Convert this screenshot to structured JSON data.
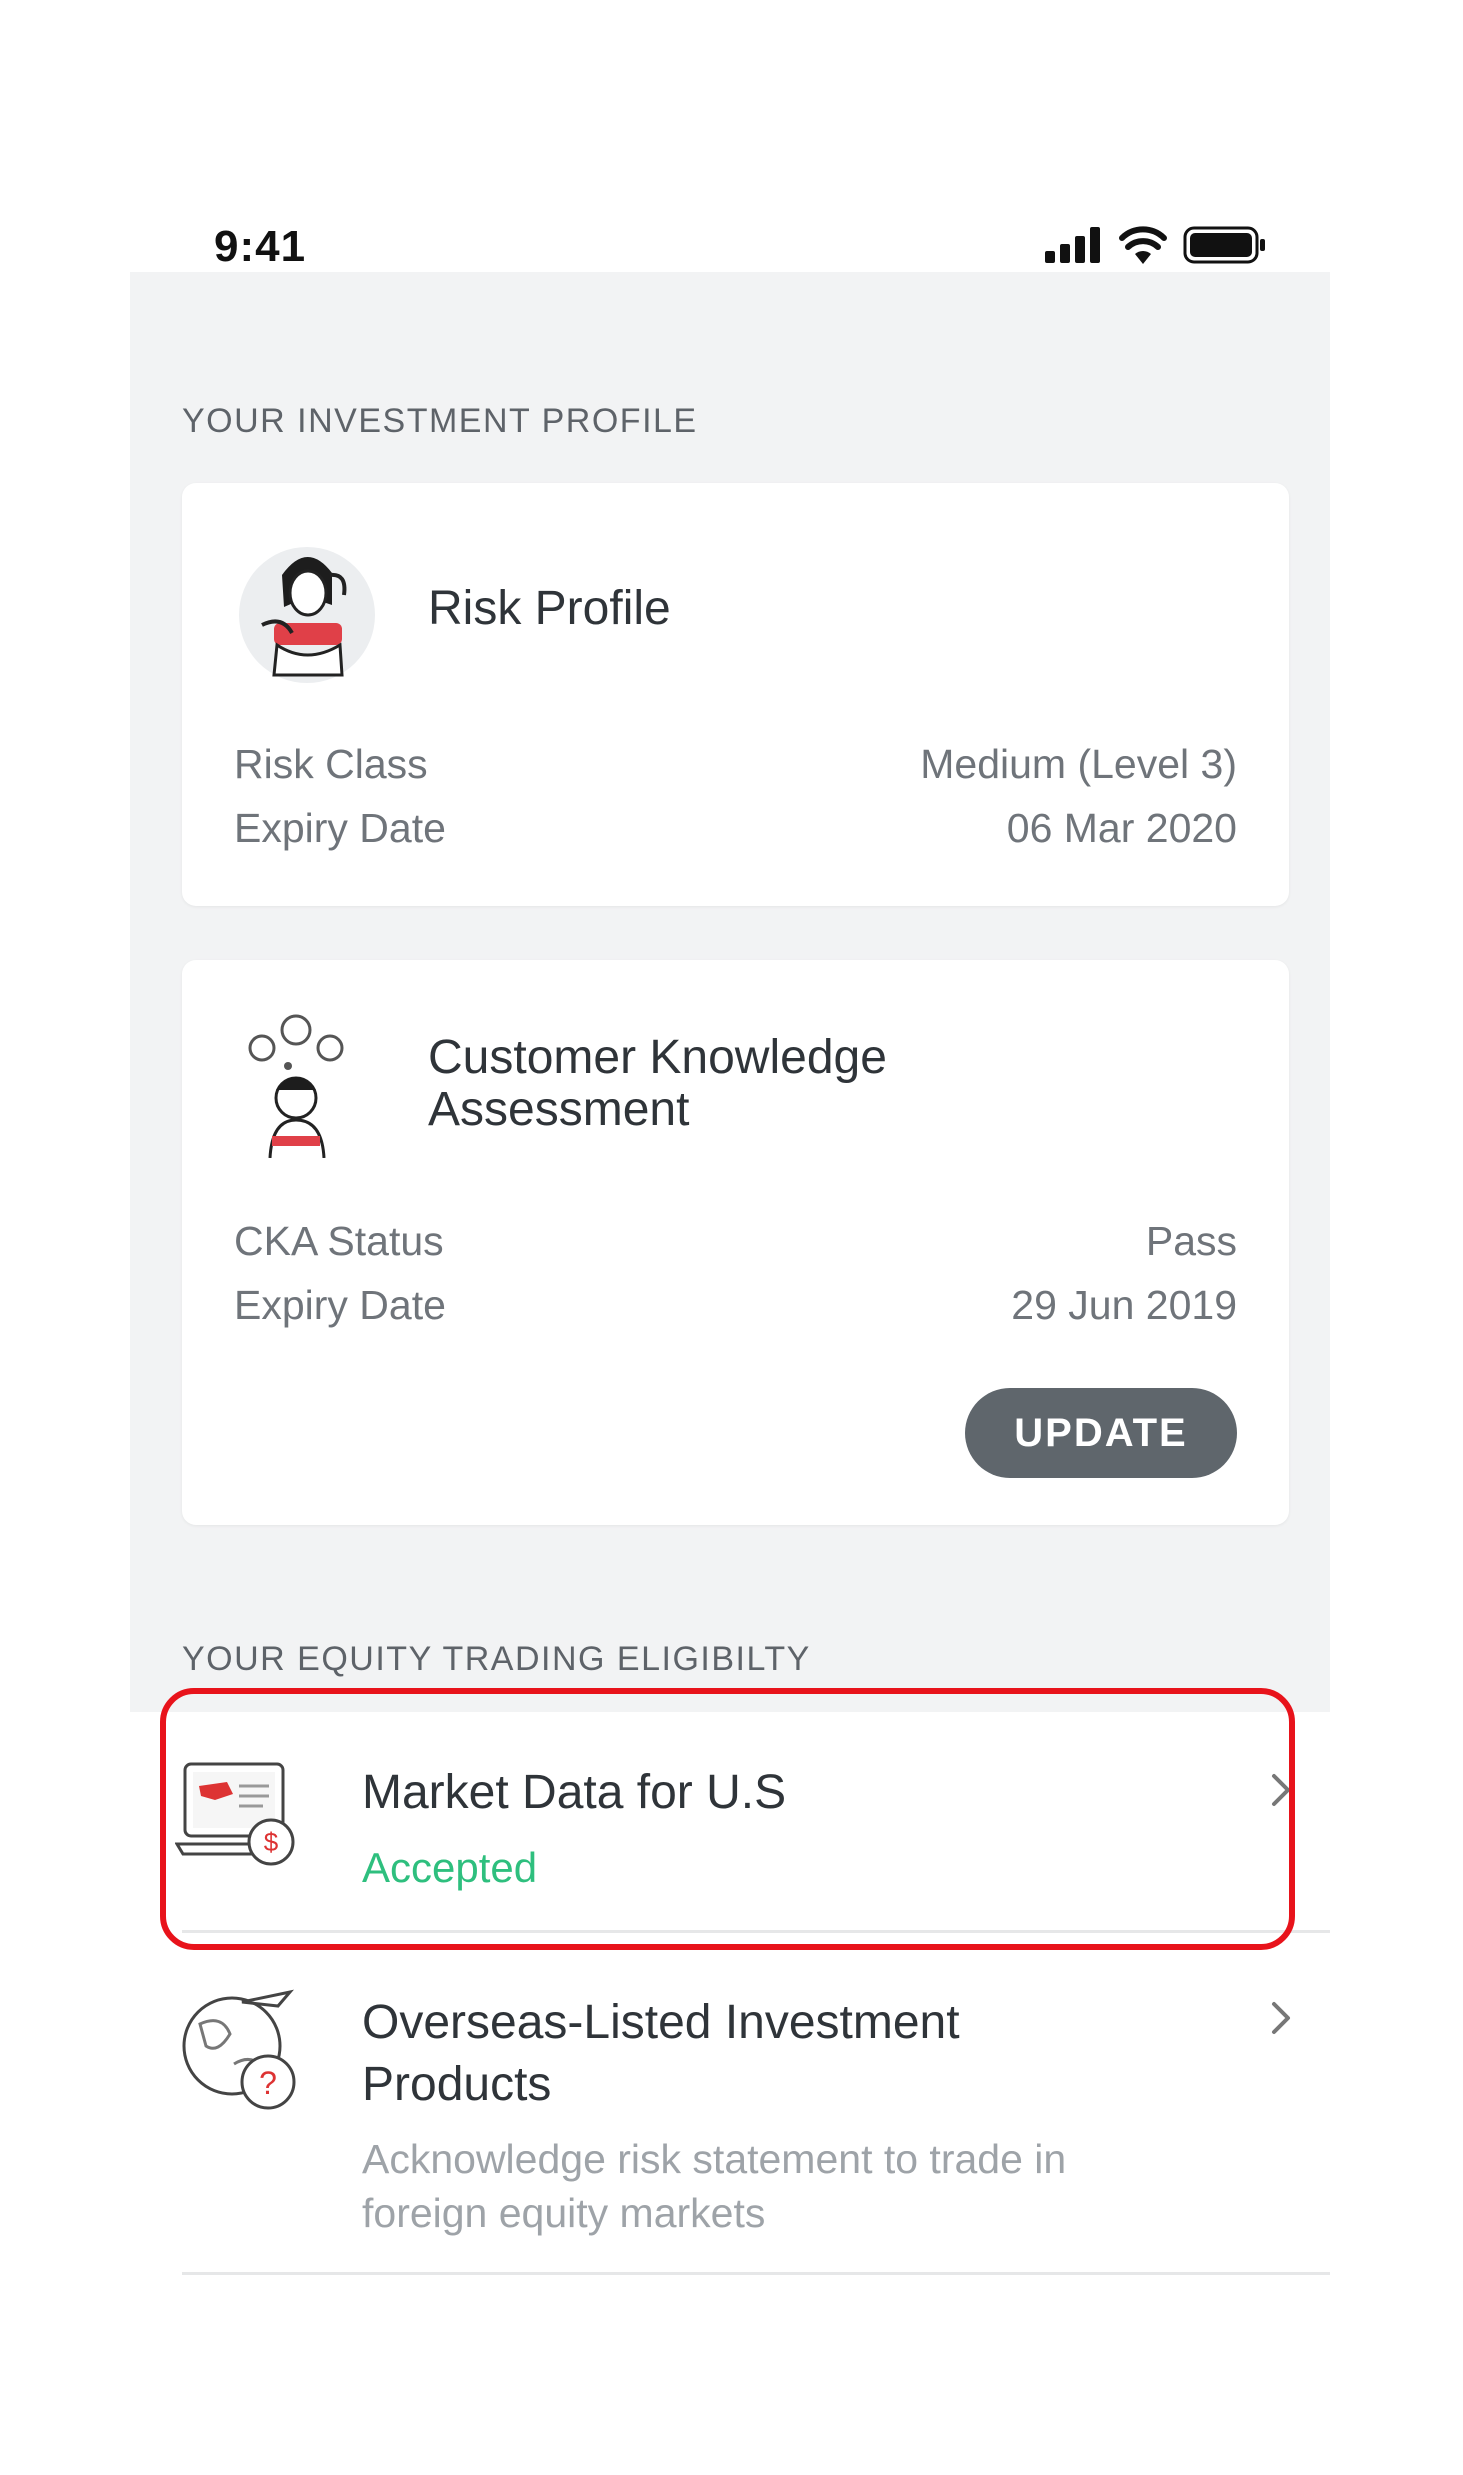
{
  "status_bar": {
    "time": "9:41",
    "icons": [
      "signal-icon",
      "wifi-icon",
      "battery-icon"
    ]
  },
  "investment_profile": {
    "section_title": "YOUR INVESTMENT PROFILE",
    "risk_profile": {
      "title": "Risk Profile",
      "rows": [
        {
          "label": "Risk Class",
          "value": "Medium (Level 3)"
        },
        {
          "label": "Expiry Date",
          "value": "06 Mar 2020"
        }
      ]
    },
    "cka": {
      "title_line1": "Customer Knowledge",
      "title_line2": "Assessment",
      "rows": [
        {
          "label": "CKA Status",
          "value": "Pass"
        },
        {
          "label": "Expiry Date",
          "value": "29 Jun 2019"
        }
      ],
      "update_label": "UPDATE"
    }
  },
  "equity_eligibility": {
    "section_title": "YOUR EQUITY TRADING ELIGIBILTY",
    "items": [
      {
        "title": "Market Data for U.S",
        "status": "Accepted"
      },
      {
        "title_line1": "Overseas-Listed Investment",
        "title_line2": "Products",
        "desc_line1": "Acknowledge risk statement to trade in",
        "desc_line2": "foreign equity markets"
      }
    ]
  },
  "colors": {
    "accent_green": "#2ebf7e",
    "highlight_red": "#e8131b",
    "button_gray": "#5f666c",
    "background_gray": "#f2f3f4"
  }
}
